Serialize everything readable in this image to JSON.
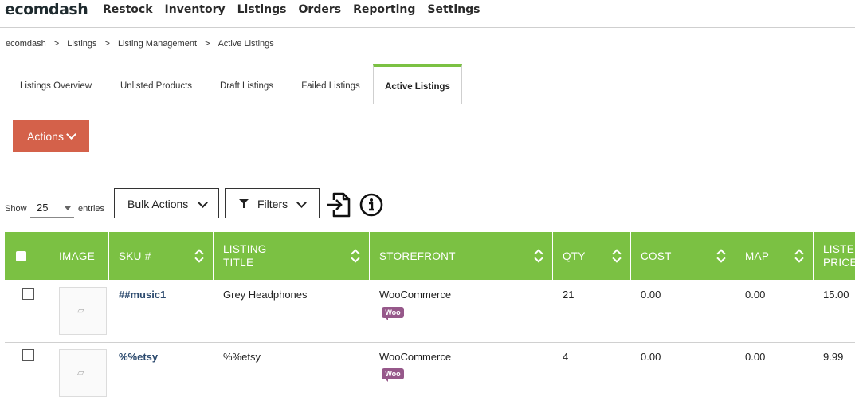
{
  "app": {
    "logo": "ecomdash"
  },
  "nav": [
    "Restock",
    "Inventory",
    "Listings",
    "Orders",
    "Reporting",
    "Settings"
  ],
  "breadcrumb": [
    "ecomdash",
    "Listings",
    "Listing Management",
    "Active Listings"
  ],
  "breadcrumb_sep": ">",
  "tabs": [
    "Listings Overview",
    "Unlisted Products",
    "Draft Listings",
    "Failed Listings",
    "Active Listings"
  ],
  "active_tab": "Active Listings",
  "actions_label": "Actions",
  "show_label": "Show",
  "show_value": "25",
  "entries_label": "entries",
  "bulk_label": "Bulk Actions",
  "filters_label": "Filters",
  "columns": {
    "image": "IMAGE",
    "sku": "SKU #",
    "title_l1": "LISTING",
    "title_l2": "TITLE",
    "storefront": "STOREFRONT",
    "qty": "QTY",
    "cost": "COST",
    "map": "MAP",
    "price_l1": "LISTED",
    "price_l2": "PRICE"
  },
  "rows": [
    {
      "sku": "##music1",
      "title": "Grey Headphones",
      "storefront": "WooCommerce",
      "badge": "Woo",
      "qty": "21",
      "cost": "0.00",
      "map": "0.00",
      "price": "15.00"
    },
    {
      "sku": "%%etsy",
      "title": "%%etsy",
      "storefront": "WooCommerce",
      "badge": "Woo",
      "qty": "4",
      "cost": "0.00",
      "map": "0.00",
      "price": "9.99"
    }
  ],
  "colors": {
    "accent": "#7bc143",
    "actions": "#d4614a",
    "sku_link": "#2c4a6e",
    "woo": "#96588a"
  }
}
